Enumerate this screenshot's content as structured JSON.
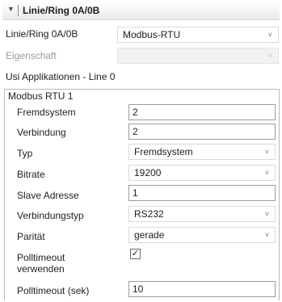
{
  "header": {
    "title": "Linie/Ring 0A/0B"
  },
  "top": {
    "line_label": "Linie/Ring 0A/0B",
    "line_value": "Modbus-RTU",
    "property_label": "Eigenschaft",
    "property_value": "",
    "usi_label": "Usi Applikationen - Line 0"
  },
  "group": {
    "title": "Modbus RTU 1",
    "fields": {
      "fremdsystem": {
        "label": "Fremdsystem",
        "value": "2"
      },
      "verbindung": {
        "label": "Verbindung",
        "value": "2"
      },
      "typ": {
        "label": "Typ",
        "value": "Fremdsystem"
      },
      "bitrate": {
        "label": "Bitrate",
        "value": "19200"
      },
      "slave": {
        "label": "Slave Adresse",
        "value": "1"
      },
      "verbindungstyp": {
        "label": "Verbindungstyp",
        "value": "RS232"
      },
      "paritaet": {
        "label": "Parität",
        "value": "gerade"
      },
      "polltimeout_use": {
        "label_line1": "Polltimeout",
        "label_line2": "verwenden",
        "checked": true
      },
      "polltimeout_sec": {
        "label": "Polltimeout (sek)",
        "value": "10"
      }
    }
  }
}
